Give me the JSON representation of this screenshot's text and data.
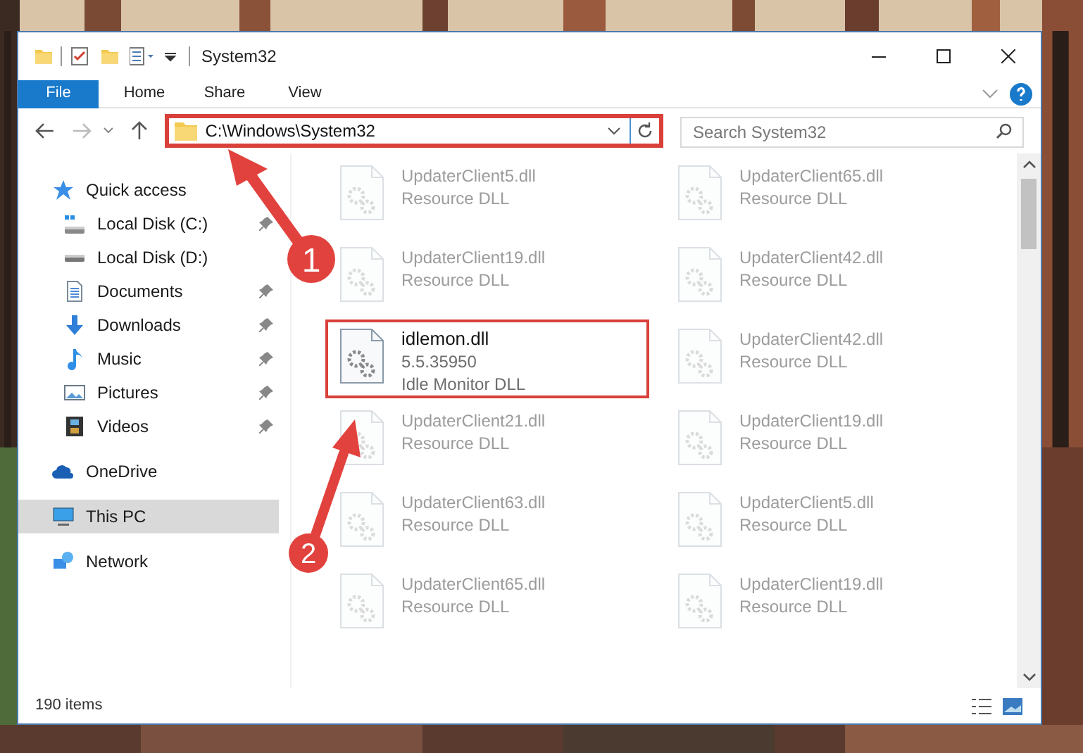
{
  "window": {
    "title": "System32"
  },
  "ribbon_tabs": [
    {
      "label": "File",
      "kind": "file"
    },
    {
      "label": "Home",
      "kind": "tab"
    },
    {
      "label": "Share",
      "kind": "tab"
    },
    {
      "label": "View",
      "kind": "tab"
    }
  ],
  "address_bar": {
    "path": "C:\\Windows\\System32",
    "highlighted": true
  },
  "search": {
    "placeholder": "Search System32"
  },
  "sidebar": {
    "items": [
      {
        "label": "Quick access",
        "kind": "star",
        "selected": false,
        "children": [
          {
            "label": "Local Disk (C:)",
            "kind": "disk-c",
            "pinned": true,
            "selected": false
          },
          {
            "label": "Local Disk (D:)",
            "kind": "disk",
            "pinned": false,
            "selected": false
          },
          {
            "label": "Documents",
            "kind": "documents",
            "pinned": true,
            "selected": false
          },
          {
            "label": "Downloads",
            "kind": "downloads",
            "pinned": true,
            "selected": false
          },
          {
            "label": "Music",
            "kind": "music",
            "pinned": true,
            "selected": false
          },
          {
            "label": "Pictures",
            "kind": "pictures",
            "pinned": true,
            "selected": false
          },
          {
            "label": "Videos",
            "kind": "videos",
            "pinned": true,
            "selected": false
          }
        ]
      },
      {
        "label": "OneDrive",
        "kind": "cloud",
        "selected": false
      },
      {
        "label": "This PC",
        "kind": "pc",
        "selected": true
      },
      {
        "label": "Network",
        "kind": "network",
        "selected": false
      }
    ]
  },
  "files": [
    {
      "name": "UpdaterClient5.dll",
      "description": "Resource DLL",
      "kind": "blurred"
    },
    {
      "name": "UpdaterClient65.dll",
      "description": "Resource DLL",
      "kind": "blurred"
    },
    {
      "name": "UpdaterClient19.dll",
      "description": "Resource DLL",
      "kind": "blurred"
    },
    {
      "name": "UpdaterClient42.dll",
      "description": "Resource DLL",
      "kind": "blurred"
    },
    {
      "name": "idlemon.dll",
      "version": "5.5.35950",
      "description": "Idle Monitor DLL",
      "kind": "clear",
      "highlighted": true
    },
    {
      "name": "UpdaterClient42.dll",
      "description": "Resource DLL",
      "kind": "blurred"
    },
    {
      "name": "UpdaterClient21.dll",
      "description": "Resource DLL",
      "kind": "blurred"
    },
    {
      "name": "UpdaterClient19.dll",
      "description": "Resource DLL",
      "kind": "blurred"
    },
    {
      "name": "UpdaterClient63.dll",
      "description": "Resource DLL",
      "kind": "blurred"
    },
    {
      "name": "UpdaterClient5.dll",
      "description": "Resource DLL",
      "kind": "blurred"
    },
    {
      "name": "UpdaterClient65.dll",
      "description": "Resource DLL",
      "kind": "blurred"
    },
    {
      "name": "UpdaterClient19.dll",
      "description": "Resource DLL",
      "kind": "blurred"
    }
  ],
  "status_bar": {
    "count": "190 items"
  },
  "annotations": [
    {
      "number": "1"
    },
    {
      "number": "2"
    }
  ]
}
